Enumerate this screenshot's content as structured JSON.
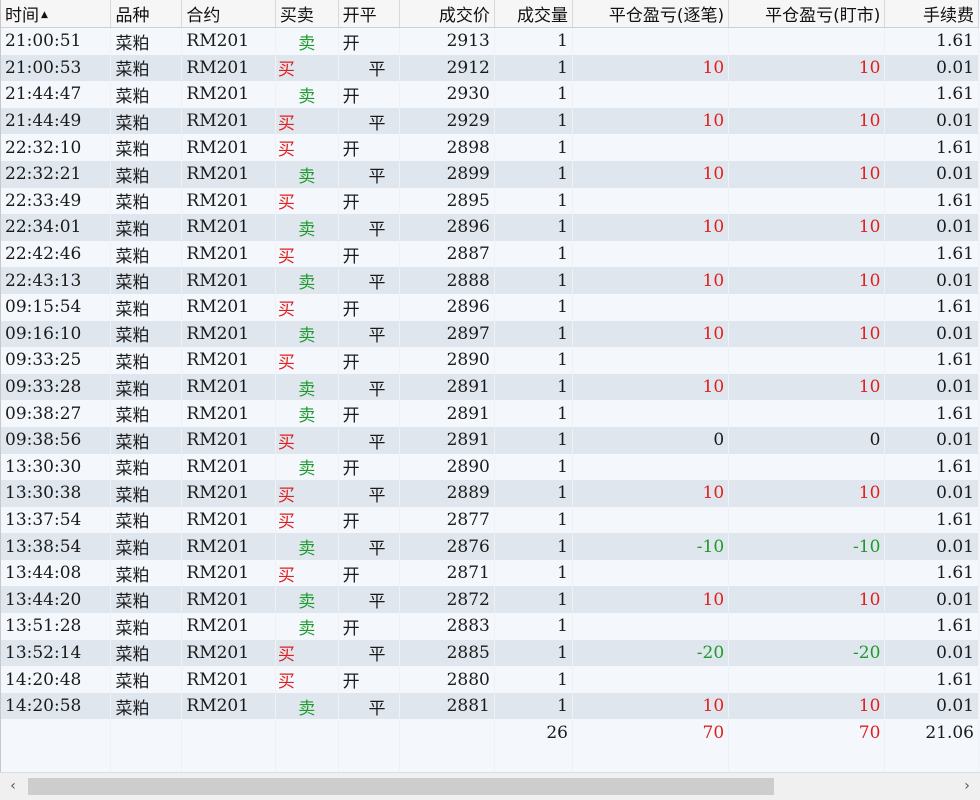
{
  "columns": [
    {
      "key": "time",
      "label": "时间",
      "align": "l"
    },
    {
      "key": "variety",
      "label": "品种",
      "align": "l"
    },
    {
      "key": "contract",
      "label": "合约",
      "align": "l"
    },
    {
      "key": "side",
      "label": "买卖",
      "align": "l"
    },
    {
      "key": "openclose",
      "label": "开平",
      "align": "l"
    },
    {
      "key": "price",
      "label": "成交价",
      "align": "r"
    },
    {
      "key": "volume",
      "label": "成交量",
      "align": "r"
    },
    {
      "key": "pnl_trade",
      "label": "平仓盈亏(逐笔)",
      "align": "r"
    },
    {
      "key": "pnl_mtm",
      "label": "平仓盈亏(盯市)",
      "align": "r"
    },
    {
      "key": "fee",
      "label": "手续费",
      "align": "r"
    }
  ],
  "sort_indicator": "▲",
  "rows": [
    {
      "time": "21:00:51",
      "variety": "菜粕",
      "contract": "RM201",
      "side": "卖",
      "openclose": "开",
      "price": "2913",
      "volume": "1",
      "pnl_trade": "",
      "pnl_mtm": "",
      "fee": "1.61"
    },
    {
      "time": "21:00:53",
      "variety": "菜粕",
      "contract": "RM201",
      "side": "买",
      "openclose": "平",
      "price": "2912",
      "volume": "1",
      "pnl_trade": "10",
      "pnl_mtm": "10",
      "fee": "0.01"
    },
    {
      "time": "21:44:47",
      "variety": "菜粕",
      "contract": "RM201",
      "side": "卖",
      "openclose": "开",
      "price": "2930",
      "volume": "1",
      "pnl_trade": "",
      "pnl_mtm": "",
      "fee": "1.61"
    },
    {
      "time": "21:44:49",
      "variety": "菜粕",
      "contract": "RM201",
      "side": "买",
      "openclose": "平",
      "price": "2929",
      "volume": "1",
      "pnl_trade": "10",
      "pnl_mtm": "10",
      "fee": "0.01"
    },
    {
      "time": "22:32:10",
      "variety": "菜粕",
      "contract": "RM201",
      "side": "买",
      "openclose": "开",
      "price": "2898",
      "volume": "1",
      "pnl_trade": "",
      "pnl_mtm": "",
      "fee": "1.61"
    },
    {
      "time": "22:32:21",
      "variety": "菜粕",
      "contract": "RM201",
      "side": "卖",
      "openclose": "平",
      "price": "2899",
      "volume": "1",
      "pnl_trade": "10",
      "pnl_mtm": "10",
      "fee": "0.01"
    },
    {
      "time": "22:33:49",
      "variety": "菜粕",
      "contract": "RM201",
      "side": "买",
      "openclose": "开",
      "price": "2895",
      "volume": "1",
      "pnl_trade": "",
      "pnl_mtm": "",
      "fee": "1.61"
    },
    {
      "time": "22:34:01",
      "variety": "菜粕",
      "contract": "RM201",
      "side": "卖",
      "openclose": "平",
      "price": "2896",
      "volume": "1",
      "pnl_trade": "10",
      "pnl_mtm": "10",
      "fee": "0.01"
    },
    {
      "time": "22:42:46",
      "variety": "菜粕",
      "contract": "RM201",
      "side": "买",
      "openclose": "开",
      "price": "2887",
      "volume": "1",
      "pnl_trade": "",
      "pnl_mtm": "",
      "fee": "1.61"
    },
    {
      "time": "22:43:13",
      "variety": "菜粕",
      "contract": "RM201",
      "side": "卖",
      "openclose": "平",
      "price": "2888",
      "volume": "1",
      "pnl_trade": "10",
      "pnl_mtm": "10",
      "fee": "0.01"
    },
    {
      "time": "09:15:54",
      "variety": "菜粕",
      "contract": "RM201",
      "side": "买",
      "openclose": "开",
      "price": "2896",
      "volume": "1",
      "pnl_trade": "",
      "pnl_mtm": "",
      "fee": "1.61"
    },
    {
      "time": "09:16:10",
      "variety": "菜粕",
      "contract": "RM201",
      "side": "卖",
      "openclose": "平",
      "price": "2897",
      "volume": "1",
      "pnl_trade": "10",
      "pnl_mtm": "10",
      "fee": "0.01"
    },
    {
      "time": "09:33:25",
      "variety": "菜粕",
      "contract": "RM201",
      "side": "买",
      "openclose": "开",
      "price": "2890",
      "volume": "1",
      "pnl_trade": "",
      "pnl_mtm": "",
      "fee": "1.61"
    },
    {
      "time": "09:33:28",
      "variety": "菜粕",
      "contract": "RM201",
      "side": "卖",
      "openclose": "平",
      "price": "2891",
      "volume": "1",
      "pnl_trade": "10",
      "pnl_mtm": "10",
      "fee": "0.01"
    },
    {
      "time": "09:38:27",
      "variety": "菜粕",
      "contract": "RM201",
      "side": "卖",
      "openclose": "开",
      "price": "2891",
      "volume": "1",
      "pnl_trade": "",
      "pnl_mtm": "",
      "fee": "1.61"
    },
    {
      "time": "09:38:56",
      "variety": "菜粕",
      "contract": "RM201",
      "side": "买",
      "openclose": "平",
      "price": "2891",
      "volume": "1",
      "pnl_trade": "0",
      "pnl_mtm": "0",
      "fee": "0.01"
    },
    {
      "time": "13:30:30",
      "variety": "菜粕",
      "contract": "RM201",
      "side": "卖",
      "openclose": "开",
      "price": "2890",
      "volume": "1",
      "pnl_trade": "",
      "pnl_mtm": "",
      "fee": "1.61"
    },
    {
      "time": "13:30:38",
      "variety": "菜粕",
      "contract": "RM201",
      "side": "买",
      "openclose": "平",
      "price": "2889",
      "volume": "1",
      "pnl_trade": "10",
      "pnl_mtm": "10",
      "fee": "0.01"
    },
    {
      "time": "13:37:54",
      "variety": "菜粕",
      "contract": "RM201",
      "side": "买",
      "openclose": "开",
      "price": "2877",
      "volume": "1",
      "pnl_trade": "",
      "pnl_mtm": "",
      "fee": "1.61"
    },
    {
      "time": "13:38:54",
      "variety": "菜粕",
      "contract": "RM201",
      "side": "卖",
      "openclose": "平",
      "price": "2876",
      "volume": "1",
      "pnl_trade": "-10",
      "pnl_mtm": "-10",
      "fee": "0.01"
    },
    {
      "time": "13:44:08",
      "variety": "菜粕",
      "contract": "RM201",
      "side": "买",
      "openclose": "开",
      "price": "2871",
      "volume": "1",
      "pnl_trade": "",
      "pnl_mtm": "",
      "fee": "1.61"
    },
    {
      "time": "13:44:20",
      "variety": "菜粕",
      "contract": "RM201",
      "side": "卖",
      "openclose": "平",
      "price": "2872",
      "volume": "1",
      "pnl_trade": "10",
      "pnl_mtm": "10",
      "fee": "0.01"
    },
    {
      "time": "13:51:28",
      "variety": "菜粕",
      "contract": "RM201",
      "side": "卖",
      "openclose": "开",
      "price": "2883",
      "volume": "1",
      "pnl_trade": "",
      "pnl_mtm": "",
      "fee": "1.61"
    },
    {
      "time": "13:52:14",
      "variety": "菜粕",
      "contract": "RM201",
      "side": "买",
      "openclose": "平",
      "price": "2885",
      "volume": "1",
      "pnl_trade": "-20",
      "pnl_mtm": "-20",
      "fee": "0.01"
    },
    {
      "time": "14:20:48",
      "variety": "菜粕",
      "contract": "RM201",
      "side": "买",
      "openclose": "开",
      "price": "2880",
      "volume": "1",
      "pnl_trade": "",
      "pnl_mtm": "",
      "fee": "1.61"
    },
    {
      "time": "14:20:58",
      "variety": "菜粕",
      "contract": "RM201",
      "side": "卖",
      "openclose": "平",
      "price": "2881",
      "volume": "1",
      "pnl_trade": "10",
      "pnl_mtm": "10",
      "fee": "0.01"
    }
  ],
  "totals": {
    "volume": "26",
    "pnl_trade": "70",
    "pnl_mtm": "70",
    "fee": "21.06"
  },
  "colors": {
    "buy": "#e0201e",
    "sell": "#1e9a2c",
    "profit": "#e0201e",
    "loss": "#1e9a2c",
    "row_alt": "#dfe6ee",
    "row": "#f4f8fd"
  },
  "icons": {
    "sort": "sort-ascending-icon",
    "scroll_left": "chevron-left-icon",
    "scroll_right": "chevron-right-icon"
  },
  "scrollbar": {
    "left_glyph": "‹",
    "right_glyph": "›"
  }
}
